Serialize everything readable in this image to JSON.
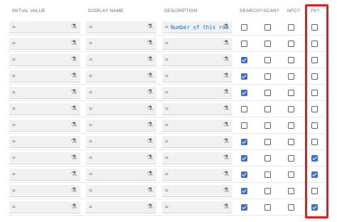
{
  "headers": {
    "initial_value": "INITIAL VALUE",
    "display_name": "DISPLAY NAME",
    "description": "DESCRIPTION",
    "search": "SEARCH?",
    "scan": "SCAN?",
    "nfc": "NFC?",
    "pii": "PII?"
  },
  "icons": {
    "field_prefix": "=",
    "formula": "⚗"
  },
  "description_text": "Number of this row",
  "colors": {
    "checkbox_checked": "#3b6fd4",
    "highlight_border": "#e41b1b",
    "link_text": "#1a73e8"
  },
  "rows": [
    {
      "description": "Number of this row",
      "search": false,
      "scan": false,
      "nfc": false,
      "pii": false
    },
    {
      "description": "",
      "search": false,
      "scan": false,
      "nfc": false,
      "pii": false
    },
    {
      "description": "",
      "search": true,
      "scan": false,
      "nfc": false,
      "pii": false
    },
    {
      "description": "",
      "search": true,
      "scan": false,
      "nfc": false,
      "pii": false
    },
    {
      "description": "",
      "search": true,
      "scan": false,
      "nfc": false,
      "pii": false
    },
    {
      "description": "",
      "search": false,
      "scan": false,
      "nfc": false,
      "pii": false
    },
    {
      "description": "",
      "search": false,
      "scan": false,
      "nfc": false,
      "pii": false
    },
    {
      "description": "",
      "search": true,
      "scan": false,
      "nfc": false,
      "pii": false
    },
    {
      "description": "",
      "search": true,
      "scan": false,
      "nfc": false,
      "pii": true
    },
    {
      "description": "",
      "search": true,
      "scan": false,
      "nfc": false,
      "pii": true
    },
    {
      "description": "",
      "search": true,
      "scan": false,
      "nfc": false,
      "pii": false
    },
    {
      "description": "",
      "search": true,
      "scan": false,
      "nfc": false,
      "pii": true
    }
  ]
}
